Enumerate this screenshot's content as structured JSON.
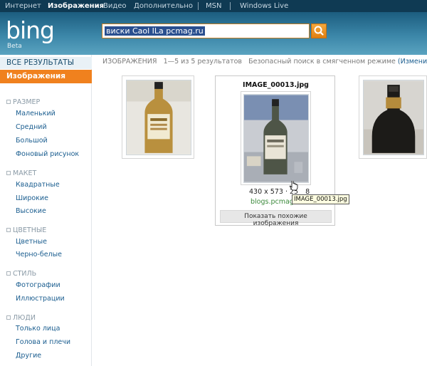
{
  "topnav": [
    "Интернет",
    "Изображения",
    "Видео",
    "Дополнительно",
    "MSN",
    "Windows Live"
  ],
  "header": {
    "logo": "bing",
    "logo_sub": "Beta",
    "query": "виски Caol ILa pcmag.ru"
  },
  "sidebar": {
    "all_results": "ВСЕ РЕЗУЛЬТАТЫ",
    "images": "Изображения",
    "groups": [
      {
        "title": "РАЗМЕР",
        "items": [
          "Маленький",
          "Средний",
          "Большой",
          "Фоновый рисунок"
        ]
      },
      {
        "title": "МАКЕТ",
        "items": [
          "Квадратные",
          "Широкие",
          "Высокие"
        ]
      },
      {
        "title": "ЦВЕТНЫЕ",
        "items": [
          "Цветные",
          "Черно-белые"
        ]
      },
      {
        "title": "СТИЛЬ",
        "items": [
          "Фотографии",
          "Иллюстрации"
        ]
      },
      {
        "title": "ЛЮДИ",
        "items": [
          "Только лица",
          "Голова и плечи",
          "Другие"
        ]
      }
    ]
  },
  "results": {
    "label": "ИЗОБРАЖЕНИЯ",
    "count": "1—5 из 5 результатов",
    "safe": "Безопасный поиск в смягченном режиме",
    "change": "(Изменить)",
    "card": {
      "title": "IMAGE_00013.jpg",
      "dims": "430 x 573 · 25",
      "dims_tail": "8",
      "source": "blogs.pcmag",
      "similar": "Показать похожие изображения",
      "tooltip": "IMAGE_00013.jpg"
    }
  }
}
